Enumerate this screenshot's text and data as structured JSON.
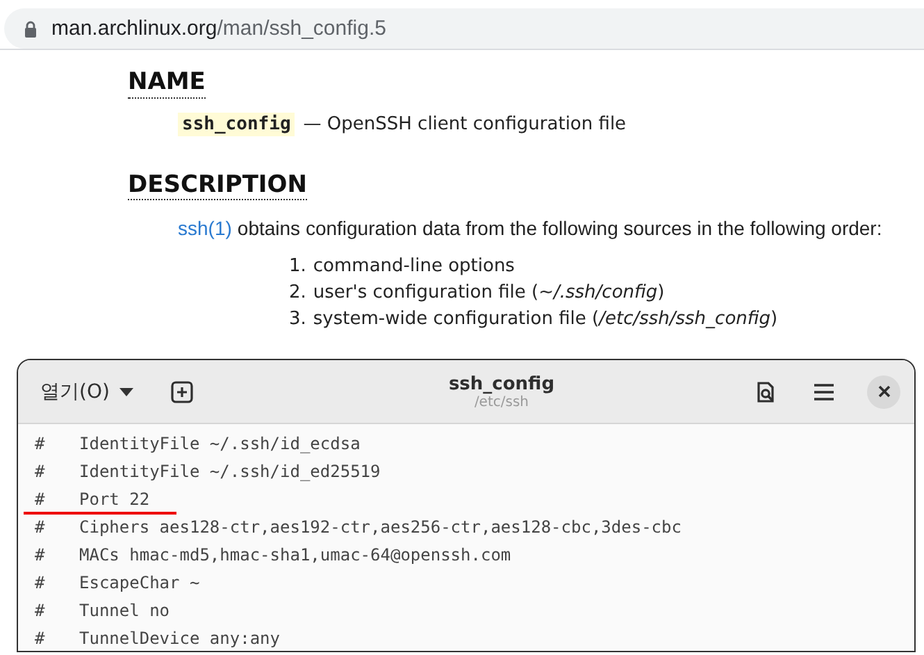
{
  "address_bar": {
    "domain": "man.archlinux.org",
    "path": "/man/ssh_config.5"
  },
  "page": {
    "name_heading": "NAME",
    "name_term": "ssh_config",
    "name_desc": "— OpenSSH client configuration file",
    "description_heading": "DESCRIPTION",
    "link": "ssh(1)",
    "intro": "obtains configuration data from the following sources in the following order:",
    "sources": [
      {
        "number": "1.",
        "text": "command-line options"
      },
      {
        "number": "2.",
        "text": "user's configuration file (*~/.ssh/config*)"
      },
      {
        "number": "3.",
        "text": "system-wide configuration file (*/etc/ssh/ssh_config*)"
      }
    ]
  },
  "editor": {
    "open_menu": "열기(O)",
    "title": "ssh_config",
    "subtitle": "/etc/ssh",
    "lines": [
      {
        "hash": "#",
        "text": "IdentityFile ~/.ssh/id_ecdsa",
        "underlined": false
      },
      {
        "hash": "#",
        "text": "IdentityFile ~/.ssh/id_ed25519",
        "underlined": false
      },
      {
        "hash": "#",
        "text": "Port 22",
        "underlined": true
      },
      {
        "hash": "#",
        "text": "Ciphers aes128-ctr,aes192-ctr,aes256-ctr,aes128-cbc,3des-cbc",
        "underlined": false
      },
      {
        "hash": "#",
        "text": "MACs hmac-md5,hmac-sha1,umac-64@openssh.com",
        "underlined": false
      },
      {
        "hash": "#",
        "text": "EscapeChar ~",
        "underlined": false
      },
      {
        "hash": "#",
        "text": "Tunnel no",
        "underlined": false
      },
      {
        "hash": "#",
        "text": "TunnelDevice any:any",
        "underlined": false
      }
    ]
  }
}
